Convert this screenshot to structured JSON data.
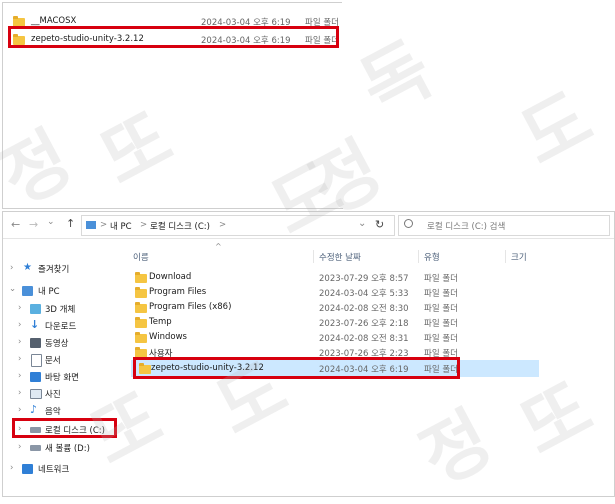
{
  "top_panel": {
    "rows": [
      {
        "name": "__MACOSX",
        "date": "2024-03-04 오후 6:19",
        "type": "파일 폴더"
      },
      {
        "name": "zepeto-studio-unity-3.2.12",
        "date": "2024-03-04 오후 6:19",
        "type": "파일 폴더"
      }
    ]
  },
  "explorer": {
    "nav": {
      "back": "←",
      "forward": "→",
      "recent": "⌄",
      "up": "↑",
      "breadcrumb": [
        "내 PC",
        "로컬 디스크 (C:)"
      ],
      "sep": ">",
      "refresh": "↻",
      "search_placeholder": "로컬 디스크 (C:) 검색"
    },
    "columns": {
      "name": "이름",
      "date": "수정한 날짜",
      "type": "유형",
      "size": "크기"
    },
    "sidebar": {
      "quick_access": "즐겨찾기",
      "this_pc": "내 PC",
      "items": [
        "3D 개체",
        "다운로드",
        "동영상",
        "문서",
        "바탕 화면",
        "사진",
        "음악",
        "로컬 디스크 (C:)",
        "새 볼륨 (D:)"
      ],
      "network": "네트워크"
    },
    "rows": [
      {
        "name": "Download",
        "date": "2023-07-29 오후 8:57",
        "type": "파일 폴더"
      },
      {
        "name": "Program Files",
        "date": "2024-03-04 오후 5:33",
        "type": "파일 폴더"
      },
      {
        "name": "Program Files (x86)",
        "date": "2024-02-08 오전 8:30",
        "type": "파일 폴더"
      },
      {
        "name": "Temp",
        "date": "2023-07-26 오후 2:18",
        "type": "파일 폴더"
      },
      {
        "name": "Windows",
        "date": "2024-02-08 오전 8:31",
        "type": "파일 폴더"
      },
      {
        "name": "사용자",
        "date": "2023-07-26 오후 2:23",
        "type": "파일 폴더"
      },
      {
        "name": "zepeto-studio-unity-3.2.12",
        "date": "2024-03-04 오후 6:19",
        "type": "파일 폴더"
      }
    ]
  },
  "watermark": [
    "정",
    "도",
    "또",
    "독"
  ],
  "colors": {
    "highlight_red": "#d7000f",
    "selected_row": "#cce8ff",
    "folder": "#f5c542"
  }
}
